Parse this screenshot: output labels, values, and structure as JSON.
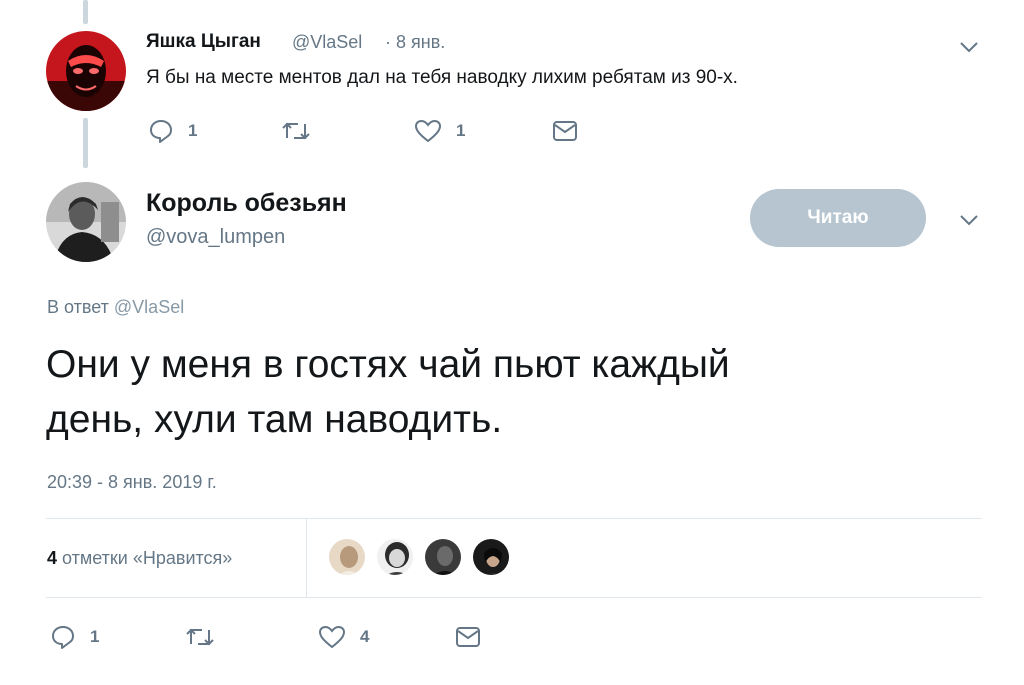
{
  "reply_tweet": {
    "display_name": "Яшка Цыган",
    "handle": "@VlaSel",
    "date": "· 8 янв.",
    "text": "Я бы на месте ментов дал на тебя наводку лихим ребятам из 90-х.",
    "reply_count": "1",
    "retweet_count": "",
    "like_count": "1"
  },
  "main_tweet": {
    "display_name": "Король обезьян",
    "handle": "@vova_lumpen",
    "follow_button_label": "Читаю",
    "reply_to_prefix": "В ответ",
    "reply_to_handle": "@VlaSel",
    "text_line1": "Они у меня в гостях чай пьют каждый",
    "text_line2": "день, хули там наводить.",
    "timestamp": "20:39 - 8 янв. 2019 г.",
    "likes_count": "4",
    "likes_label": "отметки «Нравится»",
    "reply_count": "1",
    "retweet_count": "",
    "like_count": "4"
  },
  "colors": {
    "muted": "#657786",
    "follow_button_bg": "#b6c5d0",
    "thread_line": "#ccd6dd"
  },
  "icons": [
    "chevron-down-icon",
    "reply-icon",
    "retweet-icon",
    "like-icon",
    "message-icon"
  ]
}
